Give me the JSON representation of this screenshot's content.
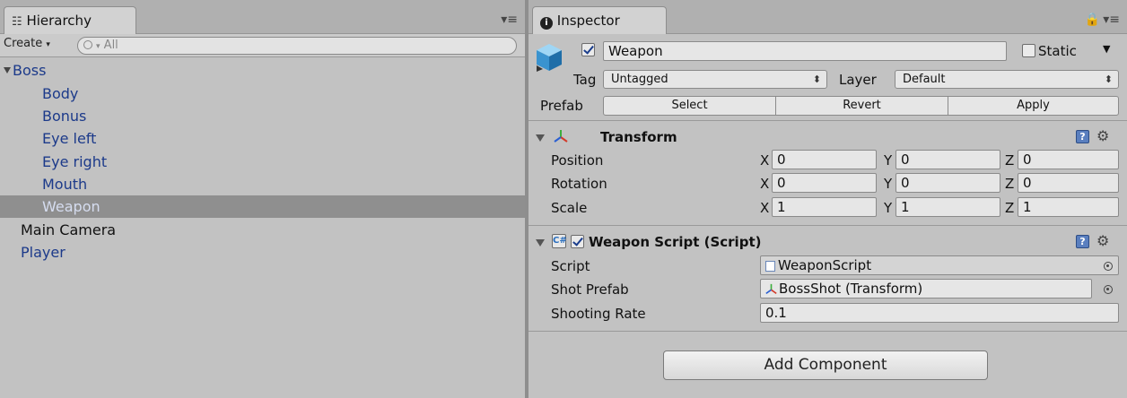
{
  "hierarchy": {
    "tab_label": "Hierarchy",
    "create_label": "Create",
    "search_placeholder": "All",
    "items": [
      {
        "label": "Boss"
      },
      {
        "label": "Body"
      },
      {
        "label": "Bonus"
      },
      {
        "label": "Eye left"
      },
      {
        "label": "Eye right"
      },
      {
        "label": "Mouth"
      },
      {
        "label": "Weapon"
      },
      {
        "label": "Main Camera"
      },
      {
        "label": "Player"
      }
    ]
  },
  "inspector": {
    "tab_label": "Inspector",
    "object": {
      "name": "Weapon",
      "active": true,
      "static_label": "Static",
      "static_checked": false,
      "tag_label": "Tag",
      "tag_value": "Untagged",
      "layer_label": "Layer",
      "layer_value": "Default"
    },
    "prefab": {
      "label": "Prefab",
      "select_label": "Select",
      "revert_label": "Revert",
      "apply_label": "Apply"
    },
    "transform": {
      "title": "Transform",
      "rows": [
        {
          "label": "Position",
          "x": "0",
          "y": "0",
          "z": "0"
        },
        {
          "label": "Rotation",
          "x": "0",
          "y": "0",
          "z": "0"
        },
        {
          "label": "Scale",
          "x": "1",
          "y": "1",
          "z": "1"
        }
      ],
      "axis_x": "X",
      "axis_y": "Y",
      "axis_z": "Z"
    },
    "weapon_script": {
      "title": "Weapon Script (Script)",
      "enabled": true,
      "script_label": "Script",
      "script_value": "WeaponScript",
      "shot_prefab_label": "Shot Prefab",
      "shot_prefab_value": "BossShot (Transform)",
      "shooting_rate_label": "Shooting Rate",
      "shooting_rate_value": "0.1"
    },
    "add_component_label": "Add Component"
  },
  "colors": {
    "panel_bg": "#c2c2c2",
    "selected_row": "#8f8f8f",
    "child_text": "#1c3a8a"
  }
}
